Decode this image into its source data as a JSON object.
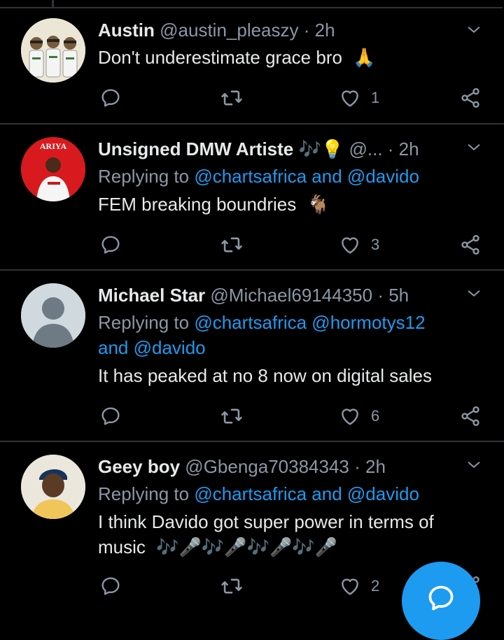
{
  "tweets": [
    {
      "name": "Austin",
      "handle": "@austin_pleaszy",
      "time": "· 2h",
      "replying_prefix": "",
      "replying_mentions": "",
      "text": "Don't underestimate grace bro",
      "emoji": "🙏",
      "likes": "1"
    },
    {
      "name": "Unsigned DMW Artiste",
      "name_emoji": "🎶💡",
      "handle": "@...",
      "time": "· 2h",
      "replying_prefix": "Replying to ",
      "replying_mentions": "@chartsafrica and @davido",
      "text": "FEM breaking boundries",
      "emoji": "🐐",
      "likes": "3",
      "avatar_label": "ARIYA"
    },
    {
      "name": "Michael Star",
      "handle": "@Michael69144350",
      "time": "· 5h",
      "replying_prefix": "Replying to ",
      "replying_mentions": "@chartsafrica @hormotys12",
      "replying_line2": "and @davido",
      "text": "It has peaked at no 8 now on digital sales",
      "likes": "6"
    },
    {
      "name": "Geey boy",
      "handle": "@Gbenga70384343",
      "time": "· 2h",
      "replying_prefix": "Replying to ",
      "replying_mentions": "@chartsafrica and @davido",
      "text_line1": "I think Davido got super power in terms of",
      "text_line2": "music",
      "emoji": "🎶🎤🎶🎤🎶🎤🎶🎤",
      "likes": "2"
    }
  ],
  "colors": {
    "background": "#000000",
    "accent": "#1d9bf0",
    "muted": "#8b98a5",
    "text": "#e7e9ea",
    "divider": "#2f3336"
  },
  "icons": [
    "reply-icon",
    "retweet-icon",
    "heart-icon",
    "share-icon",
    "chevron-down-icon",
    "compose-icon"
  ]
}
